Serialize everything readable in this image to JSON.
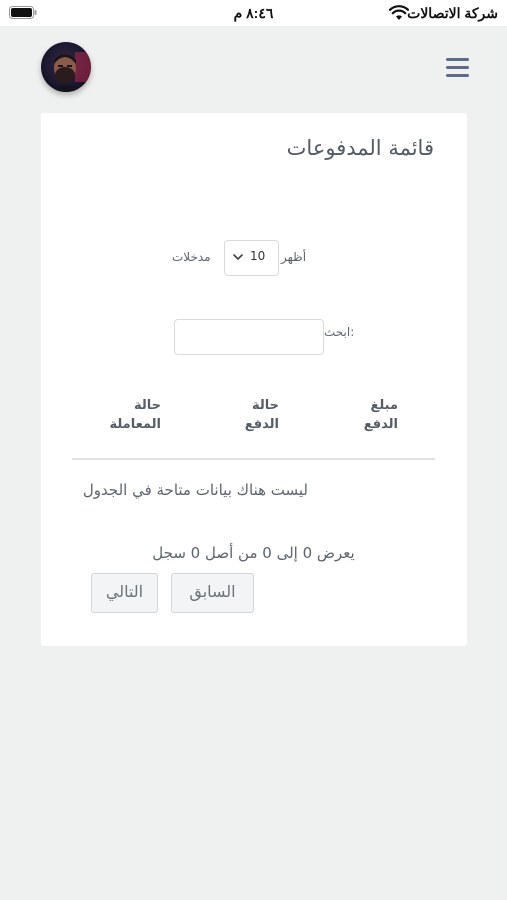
{
  "status_bar": {
    "carrier": "شركة الاتصالات",
    "time": "٨:٤٦ م"
  },
  "header": {
    "avatar_icon": "user-avatar",
    "menu_icon": "hamburger-menu-icon"
  },
  "card": {
    "title": "قائمة المدفوعات",
    "length_control": {
      "show_label": "أظهر",
      "selected_value": "10",
      "entries_label": "مدخلات"
    },
    "search": {
      "label": "ابحث:",
      "value": ""
    },
    "table": {
      "columns": [
        "مبلغ الدفع",
        "حالة الدفع",
        "حالة المعاملة"
      ],
      "empty_message": "ليست هناك بيانات متاحة في الجدول"
    },
    "info": "يعرض 0 إلى 0 من أصل 0 سجل",
    "pagination": {
      "previous": "السابق",
      "next": "التالي"
    }
  },
  "colors": {
    "background": "#eff1f1",
    "card": "#ffffff",
    "menu_icon": "#5c6b89",
    "text": "#5b6470"
  }
}
